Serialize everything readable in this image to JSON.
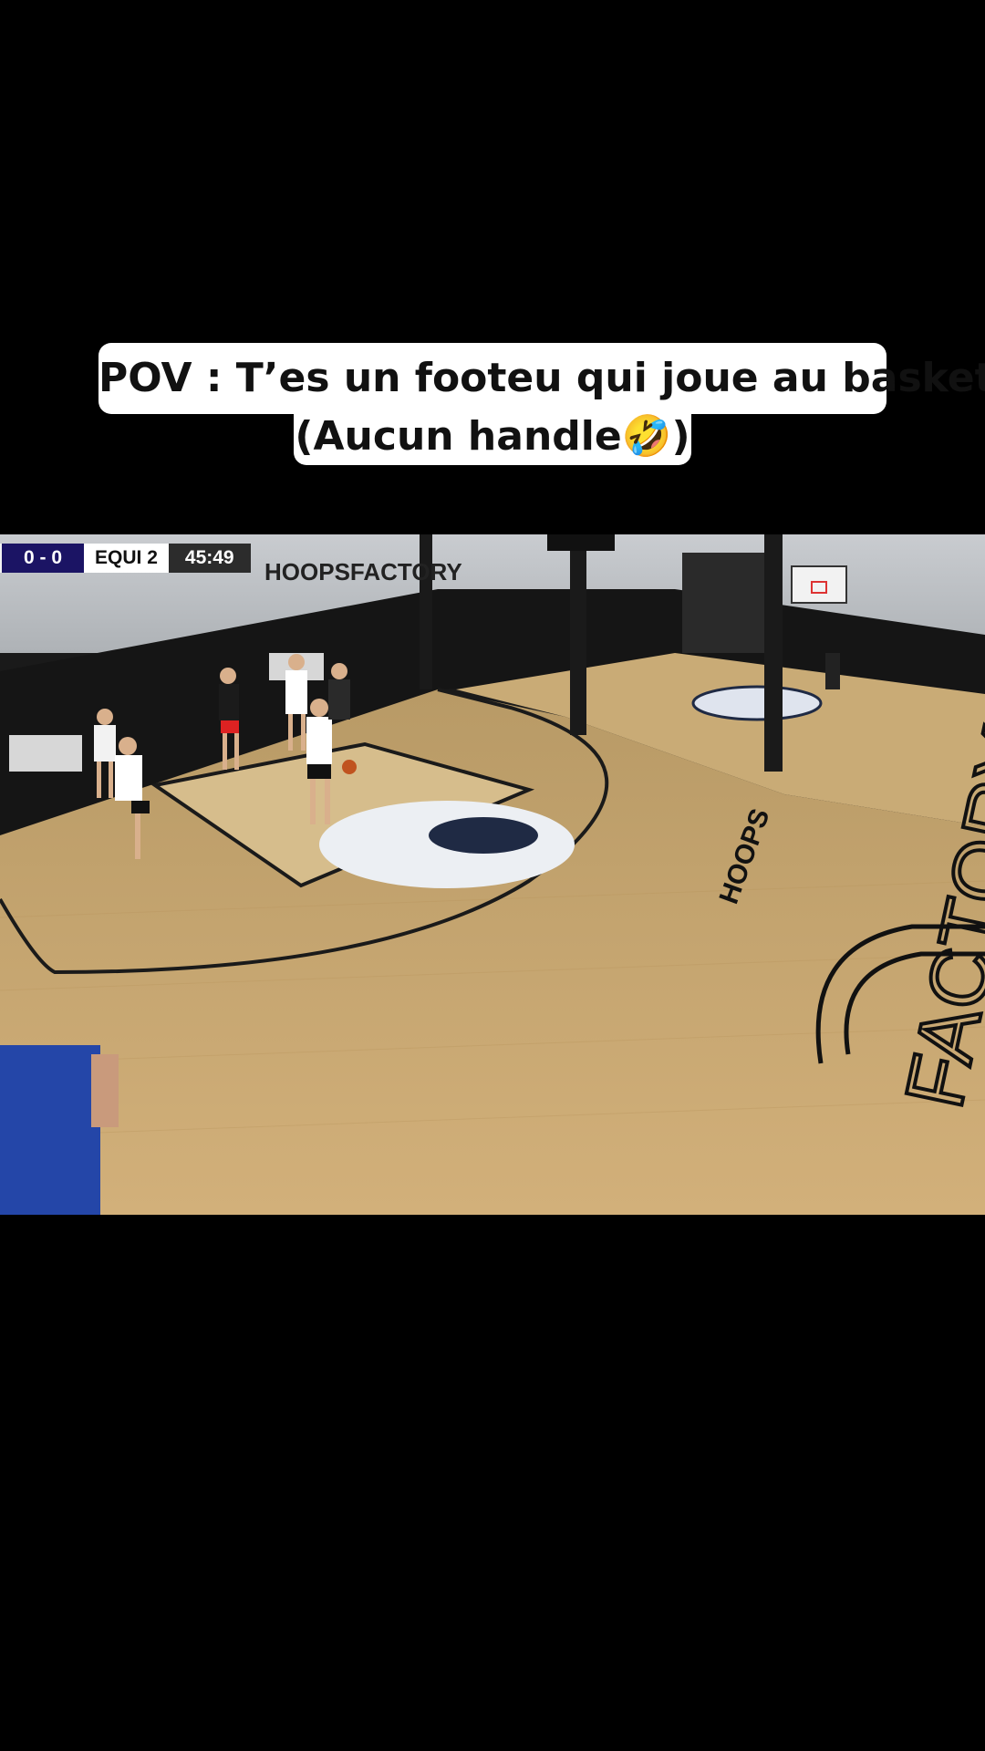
{
  "caption": {
    "line1": "POV : T’es un footeu qui joue au basket",
    "line2": "(Aucun handle🤣)"
  },
  "scoreboard": {
    "score": "0 - 0",
    "team": "EQUI 2",
    "clock": "45:49"
  },
  "video": {
    "wall_sign": "HOOPSFACTORY",
    "floor_logo_small": "HOOPS",
    "floor_logo_large": "FACTORY"
  },
  "colors": {
    "background": "#000000",
    "caption_bg": "#ffffff",
    "score_bg": "#1b1464",
    "clock_bg": "#2c2c2c",
    "floor": "#c8a66e"
  }
}
